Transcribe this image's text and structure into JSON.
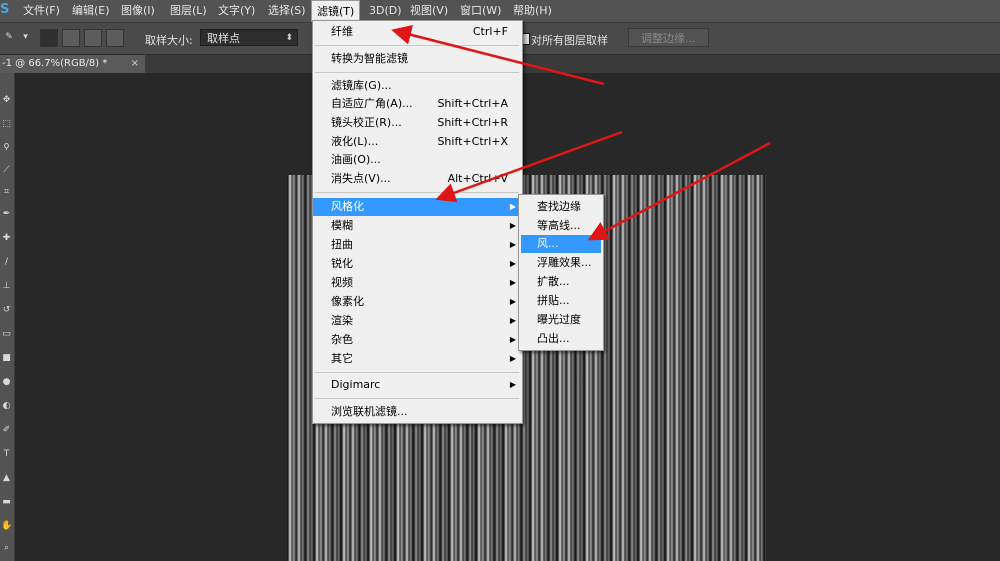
{
  "menubar": {
    "logo": "S",
    "items": [
      "文件(F)",
      "编辑(E)",
      "图像(I)",
      "图层(L)",
      "文字(Y)",
      "选择(S)",
      "滤镜(T)",
      "3D(D)",
      "视图(V)",
      "窗口(W)",
      "帮助(H)"
    ],
    "active_index": 6
  },
  "options": {
    "sample_size_label": "取样大小:",
    "sample_size_value": "取样点",
    "all_layers_label": "对所有图层取样",
    "refine_edge_label": "调整边缘..."
  },
  "document_tab": {
    "title": "-1 @ 66.7%(RGB/8) *",
    "close": "×"
  },
  "filter_menu": {
    "items": [
      {
        "label": "纤维",
        "shortcut": "Ctrl+F"
      },
      {
        "label": "转换为智能滤镜",
        "shortcut": ""
      },
      {
        "label": "滤镜库(G)...",
        "shortcut": ""
      },
      {
        "label": "自适应广角(A)...",
        "shortcut": "Shift+Ctrl+A"
      },
      {
        "label": "镜头校正(R)...",
        "shortcut": "Shift+Ctrl+R"
      },
      {
        "label": "液化(L)...",
        "shortcut": "Shift+Ctrl+X"
      },
      {
        "label": "油画(O)...",
        "shortcut": ""
      },
      {
        "label": "消失点(V)...",
        "shortcut": "Alt+Ctrl+V"
      },
      {
        "label": "风格化",
        "shortcut": "",
        "submenu": true,
        "highlighted": true
      },
      {
        "label": "模糊",
        "shortcut": "",
        "submenu": true
      },
      {
        "label": "扭曲",
        "shortcut": "",
        "submenu": true
      },
      {
        "label": "锐化",
        "shortcut": "",
        "submenu": true
      },
      {
        "label": "视频",
        "shortcut": "",
        "submenu": true
      },
      {
        "label": "像素化",
        "shortcut": "",
        "submenu": true
      },
      {
        "label": "渲染",
        "shortcut": "",
        "submenu": true
      },
      {
        "label": "杂色",
        "shortcut": "",
        "submenu": true
      },
      {
        "label": "其它",
        "shortcut": "",
        "submenu": true
      },
      {
        "label": "Digimarc",
        "shortcut": "",
        "submenu": true
      },
      {
        "label": "浏览联机滤镜...",
        "shortcut": ""
      }
    ]
  },
  "stylize_submenu": {
    "items": [
      {
        "label": "查找边缘"
      },
      {
        "label": "等高线..."
      },
      {
        "label": "风...",
        "highlighted": true
      },
      {
        "label": "浮雕效果..."
      },
      {
        "label": "扩散..."
      },
      {
        "label": "拼贴..."
      },
      {
        "label": "曝光过度"
      },
      {
        "label": "凸出..."
      }
    ]
  },
  "colors": {
    "menu_highlight": "#3399ff",
    "annotation_arrow": "#e01515",
    "ui_dark": "#535353",
    "workspace": "#282828"
  },
  "icons": {
    "submenu_arrow": "▶",
    "dropdown_arrow": "⬍"
  }
}
